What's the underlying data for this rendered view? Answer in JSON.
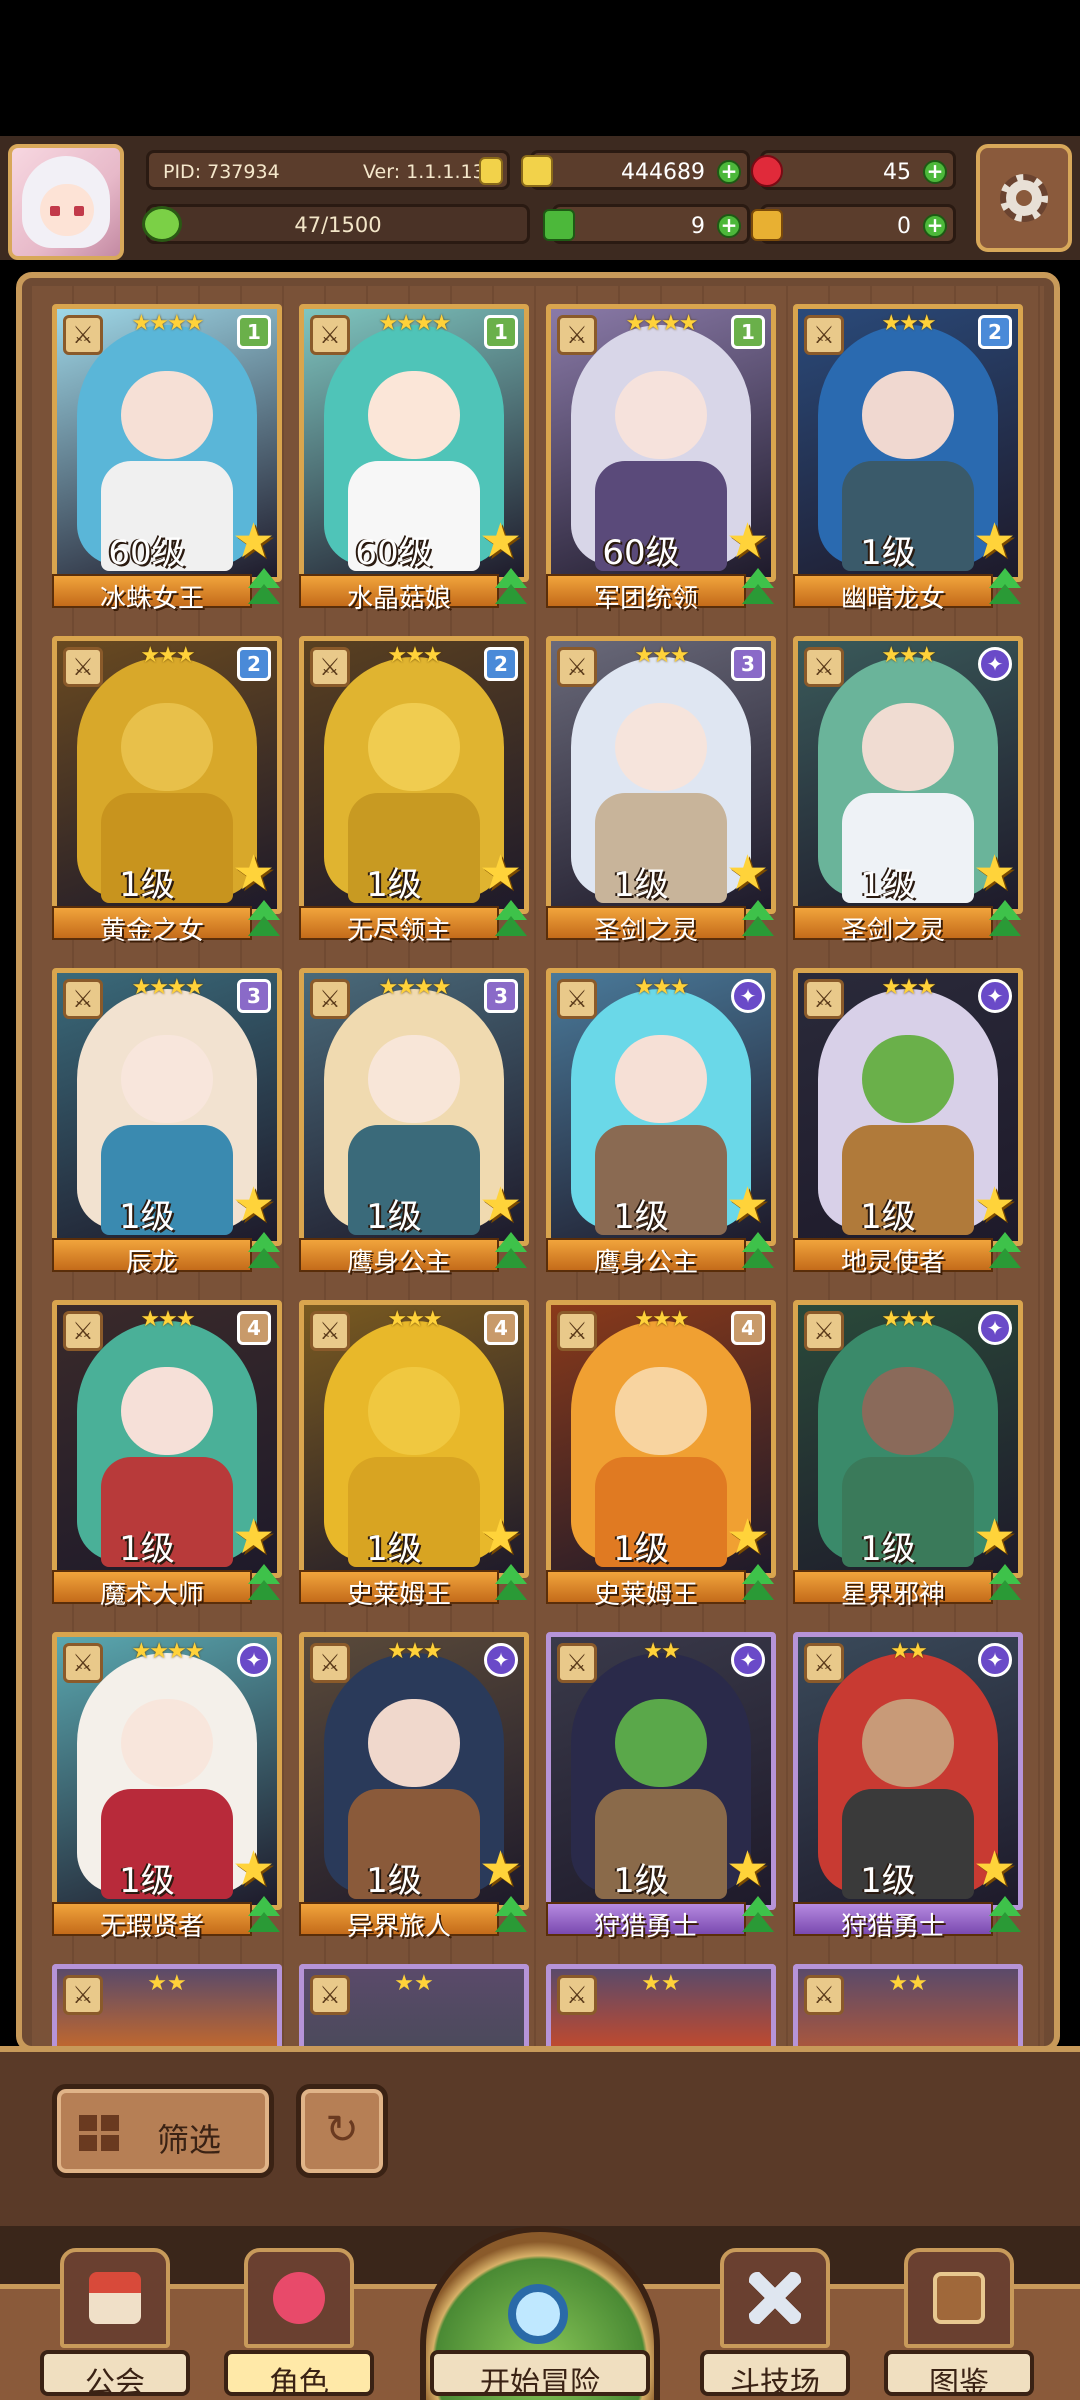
{
  "header": {
    "pid": "PID: 737934",
    "version": "Ver: 1.1.1.13",
    "xp_text": "47/1500",
    "xp_fraction": 0.031,
    "gold": "444689",
    "gems": "45",
    "clover": "9",
    "keys": "0"
  },
  "cards": [
    {
      "name": "冰蛛女王",
      "level": "60级",
      "rank": "1",
      "stars": "★★★★",
      "theme": "#9fd8e8",
      "hair": "#5ab6d8",
      "face": "#f6e0d6",
      "body": "#f0f0f0"
    },
    {
      "name": "水晶菇娘",
      "level": "60级",
      "rank": "1",
      "stars": "★★★★",
      "theme": "#7fc6c0",
      "hair": "#4fc4b8",
      "face": "#fbe6d8",
      "body": "#f7f7f7"
    },
    {
      "name": "军团统领",
      "level": "60级",
      "rank": "1",
      "stars": "★★★★",
      "theme": "#8a7aa8",
      "hair": "#d8d6e8",
      "face": "#f6e2dc",
      "body": "#5a4a7a"
    },
    {
      "name": "幽暗龙女",
      "level": "1级",
      "rank": "2",
      "stars": "★★★",
      "theme": "#2a4a7a",
      "hair": "#2a6ab0",
      "face": "#f0d8d0",
      "body": "#3a5a6a"
    },
    {
      "name": "黄金之女",
      "level": "1级",
      "rank": "2",
      "stars": "★★★",
      "theme": "#6a4a20",
      "hair": "#d8a82a",
      "face": "#e8c04a",
      "body": "#c8941e"
    },
    {
      "name": "无尽领主",
      "level": "1级",
      "rank": "2",
      "stars": "★★★",
      "theme": "#5a4020",
      "hair": "#e0b430",
      "face": "#f0cc50",
      "body": "#c89a22"
    },
    {
      "name": "圣剑之灵",
      "level": "1级",
      "rank": "3",
      "stars": "★★★",
      "theme": "#6a6a7a",
      "hair": "#dfe6f2",
      "face": "#f6e4dc",
      "body": "#c8b49a"
    },
    {
      "name": "圣剑之灵",
      "level": "1级",
      "rank": "",
      "stars": "★★★",
      "theme": "#3a5a5a",
      "hair": "#6ab49a",
      "face": "#f0dcd2",
      "body": "#eef2f6"
    },
    {
      "name": "辰龙",
      "level": "1级",
      "rank": "3",
      "stars": "★★★★",
      "theme": "#3a6a7a",
      "hair": "#f2e2d0",
      "face": "#f8e6dc",
      "body": "#3a8ab0"
    },
    {
      "name": "鹰身公主",
      "level": "1级",
      "rank": "3",
      "stars": "★★★★",
      "theme": "#4a6a7a",
      "hair": "#f0dab0",
      "face": "#f8e6d8",
      "body": "#3a6a7a"
    },
    {
      "name": "鹰身公主",
      "level": "1级",
      "rank": "",
      "stars": "★★★",
      "theme": "#4a7a9a",
      "hair": "#6ad8e8",
      "face": "#f6e0d6",
      "body": "#8a6a52"
    },
    {
      "name": "地灵使者",
      "level": "1级",
      "rank": "",
      "stars": "★★★",
      "theme": "#2a2a3a",
      "hair": "#d8d0e8",
      "face": "#6ab04a",
      "body": "#b07a3a"
    },
    {
      "name": "魔术大师",
      "level": "1级",
      "rank": "4",
      "stars": "★★★",
      "theme": "#3a2a2a",
      "hair": "#4ab098",
      "face": "#f6e0d8",
      "body": "#b83a3a"
    },
    {
      "name": "史莱姆王",
      "level": "1级",
      "rank": "4",
      "stars": "★★★",
      "theme": "#7a5a20",
      "hair": "#e8b82a",
      "face": "#f0c840",
      "body": "#d8a422"
    },
    {
      "name": "史莱姆王",
      "level": "1级",
      "rank": "4",
      "stars": "★★★",
      "theme": "#8a3a1a",
      "hair": "#f0a032",
      "face": "#f8d4a0",
      "body": "#e07a22"
    },
    {
      "name": "星界邪神",
      "level": "1级",
      "rank": "",
      "stars": "★★★",
      "theme": "#2a4a3a",
      "hair": "#3a8a6a",
      "face": "#8a6a5a",
      "body": "#3a7a5a"
    },
    {
      "name": "无瑕贤者",
      "level": "1级",
      "rank": "",
      "stars": "★★★★",
      "theme": "#5aa8b0",
      "hair": "#f4f0ea",
      "face": "#f8e6dc",
      "body": "#b82a3a"
    },
    {
      "name": "异界旅人",
      "level": "1级",
      "rank": "",
      "stars": "★★★",
      "theme": "#5a4a3a",
      "hair": "#2a3a5a",
      "face": "#f0d8cc",
      "body": "#8a5a3a"
    },
    {
      "name": "狩猎勇士",
      "level": "1级",
      "rank": "",
      "stars": "★★",
      "theme": "#3a3a4a",
      "hair": "#2a2a4a",
      "face": "#5aa84a",
      "body": "#8a6a4a"
    },
    {
      "name": "狩猎勇士",
      "level": "1级",
      "rank": "",
      "stars": "★★",
      "theme": "#3a4a5a",
      "hair": "#c83a32",
      "face": "#c89a78",
      "body": "#3a3a3a"
    }
  ],
  "peek_stars": [
    "★★",
    "★★",
    "★★",
    "★★"
  ],
  "filter_label": "筛选",
  "nav": {
    "guild": "公会",
    "character": "角色",
    "adventure": "开始冒险",
    "arena": "斗技场",
    "codex": "图鉴"
  },
  "colors": {
    "rank1": "#6ab04a",
    "rank2": "#4a8ad8",
    "rank3": "#8a6ac8",
    "rank4": "#c89a6a",
    "plus": "#4cb83a",
    "frame_gold": "#d9a54e",
    "frame_purple": "#b694d8"
  }
}
